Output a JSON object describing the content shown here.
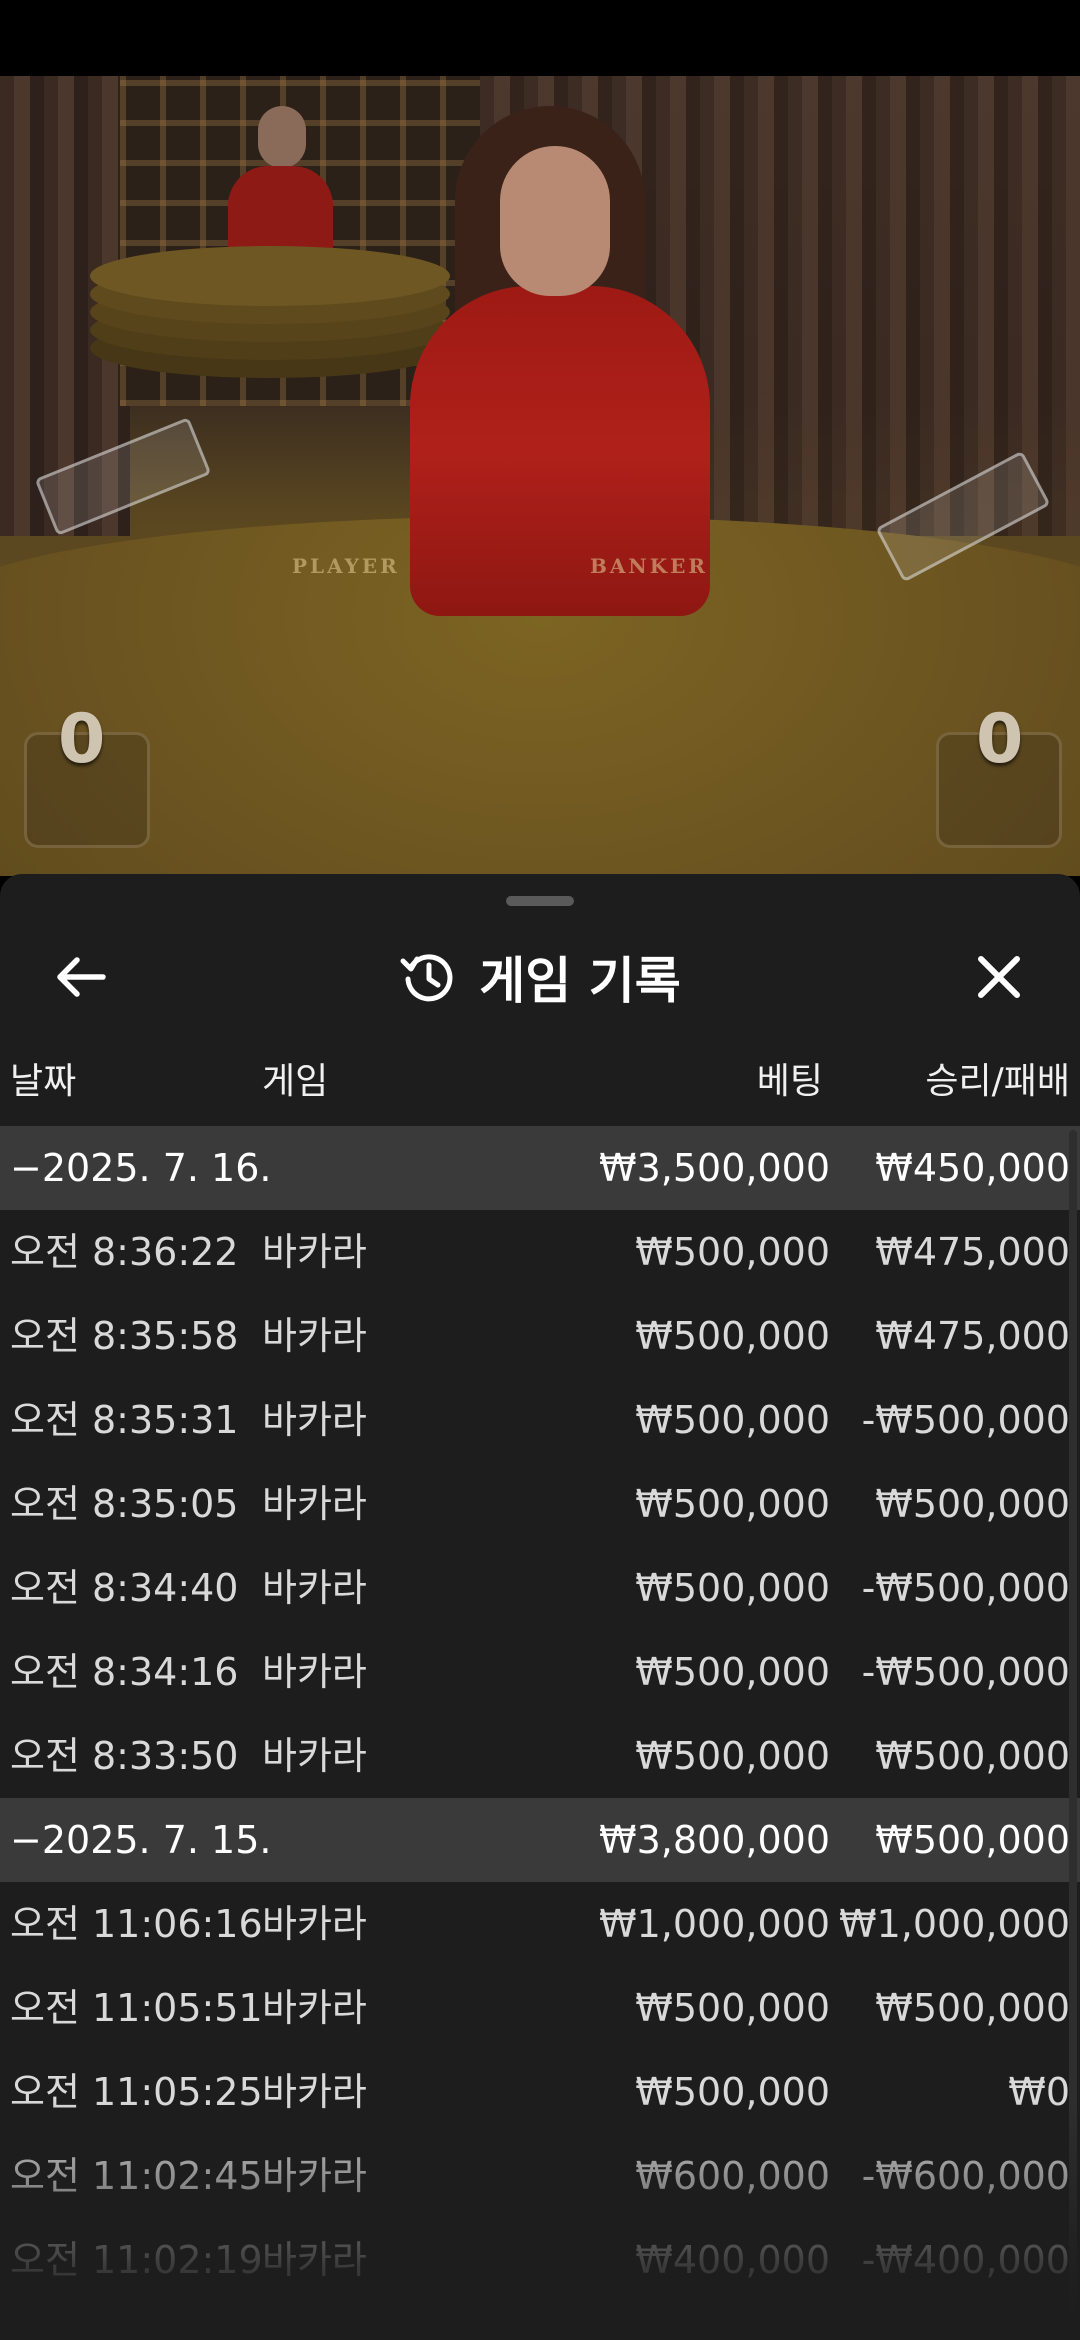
{
  "video": {
    "felt_left": "PLAYER",
    "felt_right": "BANKER",
    "player_score": "0",
    "banker_score": "0"
  },
  "sheet": {
    "title": "게임 기록",
    "icons": {
      "back": "arrow-left-icon",
      "history": "history-icon",
      "close": "close-icon"
    },
    "columns": {
      "date": "날짜",
      "game": "게임",
      "bet": "베팅",
      "win_loss": "승리/패배"
    },
    "groups": [
      {
        "date": "−2025. 7. 16.",
        "bet_total": "₩3,500,000",
        "win_total": "₩450,000",
        "rows": [
          {
            "time": "오전 8:36:22",
            "game": "바카라",
            "bet": "₩500,000",
            "win": "₩475,000"
          },
          {
            "time": "오전 8:35:58",
            "game": "바카라",
            "bet": "₩500,000",
            "win": "₩475,000"
          },
          {
            "time": "오전 8:35:31",
            "game": "바카라",
            "bet": "₩500,000",
            "win": "-₩500,000"
          },
          {
            "time": "오전 8:35:05",
            "game": "바카라",
            "bet": "₩500,000",
            "win": "₩500,000"
          },
          {
            "time": "오전 8:34:40",
            "game": "바카라",
            "bet": "₩500,000",
            "win": "-₩500,000"
          },
          {
            "time": "오전 8:34:16",
            "game": "바카라",
            "bet": "₩500,000",
            "win": "-₩500,000"
          },
          {
            "time": "오전 8:33:50",
            "game": "바카라",
            "bet": "₩500,000",
            "win": "₩500,000"
          }
        ]
      },
      {
        "date": "−2025. 7. 15.",
        "bet_total": "₩3,800,000",
        "win_total": "₩500,000",
        "rows": [
          {
            "time": "오전 11:06:16",
            "game": "바카라",
            "bet": "₩1,000,000",
            "win": "₩1,000,000"
          },
          {
            "time": "오전 11:05:51",
            "game": "바카라",
            "bet": "₩500,000",
            "win": "₩500,000"
          },
          {
            "time": "오전 11:05:25",
            "game": "바카라",
            "bet": "₩500,000",
            "win": "₩0"
          },
          {
            "time": "오전 11:02:45",
            "game": "바카라",
            "bet": "₩600,000",
            "win": "-₩600,000"
          },
          {
            "time": "오전 11:02:19",
            "game": "바카라",
            "bet": "₩400,000",
            "win": "-₩400,000"
          }
        ]
      }
    ]
  }
}
